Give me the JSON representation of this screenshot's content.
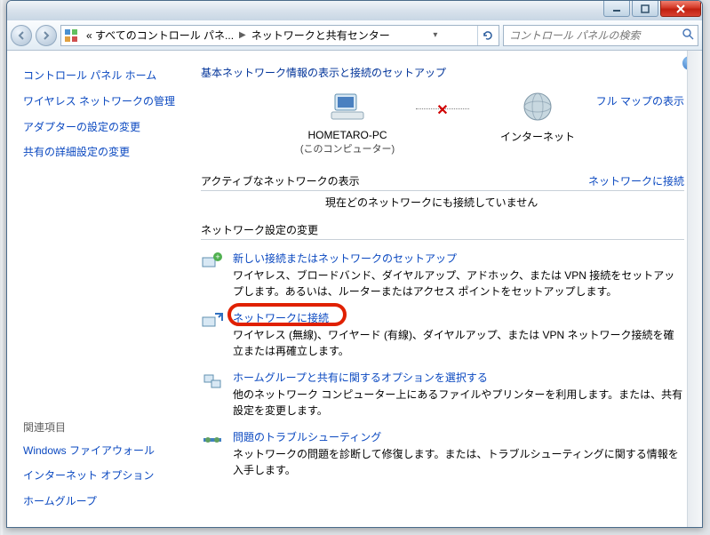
{
  "titlebar": {
    "minimize": "minimize",
    "maximize": "maximize",
    "close": "close"
  },
  "nav": {
    "back": "back",
    "forward": "forward"
  },
  "address": {
    "crumb1": "« すべてのコントロール パネ...",
    "crumb2": "ネットワークと共有センター"
  },
  "search": {
    "placeholder": "コントロール パネルの検索"
  },
  "sidebar": {
    "home": "コントロール パネル ホーム",
    "items": [
      "ワイヤレス ネットワークの管理",
      "アダプターの設定の変更",
      "共有の詳細設定の変更"
    ],
    "related_header": "関連項目",
    "related": [
      "Windows ファイアウォール",
      "インターネット オプション",
      "ホームグループ"
    ]
  },
  "main": {
    "heading": "基本ネットワーク情報の表示と接続のセットアップ",
    "fullmap_link": "フル マップの表示",
    "node1_name": "HOMETARO-PC",
    "node1_sub": "(このコンピューター)",
    "node2_name": "インターネット",
    "active_section": "アクティブなネットワークの表示",
    "connect_link": "ネットワークに接続",
    "no_connection": "現在どのネットワークにも接続していません",
    "settings_section": "ネットワーク設定の変更",
    "options": [
      {
        "title": "新しい接続またはネットワークのセットアップ",
        "desc": "ワイヤレス、ブロードバンド、ダイヤルアップ、アドホック、または VPN 接続をセットアップします。あるいは、ルーターまたはアクセス ポイントをセットアップします。"
      },
      {
        "title": "ネットワークに接続",
        "desc": "ワイヤレス (無線)、ワイヤード (有線)、ダイヤルアップ、または VPN ネットワーク接続を確立または再確立します。"
      },
      {
        "title": "ホームグループと共有に関するオプションを選択する",
        "desc": "他のネットワーク コンピューター上にあるファイルやプリンターを利用します。または、共有設定を変更します。"
      },
      {
        "title": "問題のトラブルシューティング",
        "desc": "ネットワークの問題を診断して修復します。または、トラブルシューティングに関する情報を入手します。"
      }
    ]
  }
}
